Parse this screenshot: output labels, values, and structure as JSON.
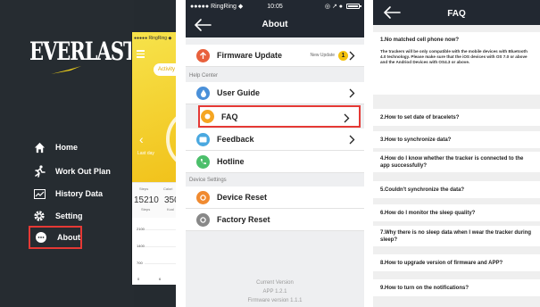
{
  "menu": {
    "brand": "EVERLAST",
    "items": [
      {
        "label": "Home",
        "icon": "home-icon"
      },
      {
        "label": "Work Out Plan",
        "icon": "runner-icon"
      },
      {
        "label": "History Data",
        "icon": "chart-icon"
      },
      {
        "label": "Setting",
        "icon": "gear-icon"
      },
      {
        "label": "About",
        "icon": "chat-bubble-icon"
      }
    ],
    "highlight_color": "#e53935"
  },
  "peek": {
    "status": "●●●●● RingRing ◆",
    "activity_button": "Activity",
    "last_day": "Last day",
    "stats": [
      {
        "label": "Steps",
        "value": "15210",
        "unit": "Steps"
      },
      {
        "label": "Calori",
        "value": "350",
        "unit": "Kcal"
      }
    ],
    "chart_ticks": [
      "2100",
      "1400",
      "700",
      "0"
    ],
    "chart_x": [
      "0",
      "6"
    ]
  },
  "about": {
    "status": {
      "carrier": "●●●●● RingRing ◆",
      "time": "10:05",
      "icons": "◎ ↗ ●"
    },
    "title": "About",
    "firmware": {
      "label": "Firmware Update",
      "note": "New Update",
      "badge": "1"
    },
    "sections": {
      "help": "Help Center",
      "device": "Device Settings"
    },
    "help_rows": [
      "User Guide",
      "FAQ",
      "Feedback",
      "Hotline"
    ],
    "device_rows": [
      "Device Reset",
      "Factory Reset"
    ],
    "version": {
      "line1": "Current Version",
      "line2": "APP 1.2.1",
      "line3": "Firmware version 1.1.1"
    },
    "colors": {
      "firmware": "#e8603c",
      "guide": "#4a90d9",
      "faq": "#f5a623",
      "feedback": "#4aa8e0",
      "hotline": "#4cbf6b",
      "reset": "#f08a30",
      "factory": "#888888"
    }
  },
  "faq": {
    "title": "FAQ",
    "first": {
      "q": "1.No matched cell phone now?",
      "a": "The trackers will be only compatible with the mobile devices with Bluetooth 4.0 technology. Please make sure that the iOS devices with OS 7.0 or above and the Andriod Devices with OS4.3 or above."
    },
    "items": [
      "2.How to set date of bracelets?",
      "3.How to synchronize data?",
      "4.How do I know whether the tracker is connected to the app successfully?",
      "5.Couldn't synchronize the data?",
      "6.How do I monitor the sleep quality?",
      "7.Why there is no sleep data when I wear the tracker during sleep?",
      "8.How to upgrade version of firmware and APP?",
      "9.How to turn on the notifications?"
    ]
  }
}
